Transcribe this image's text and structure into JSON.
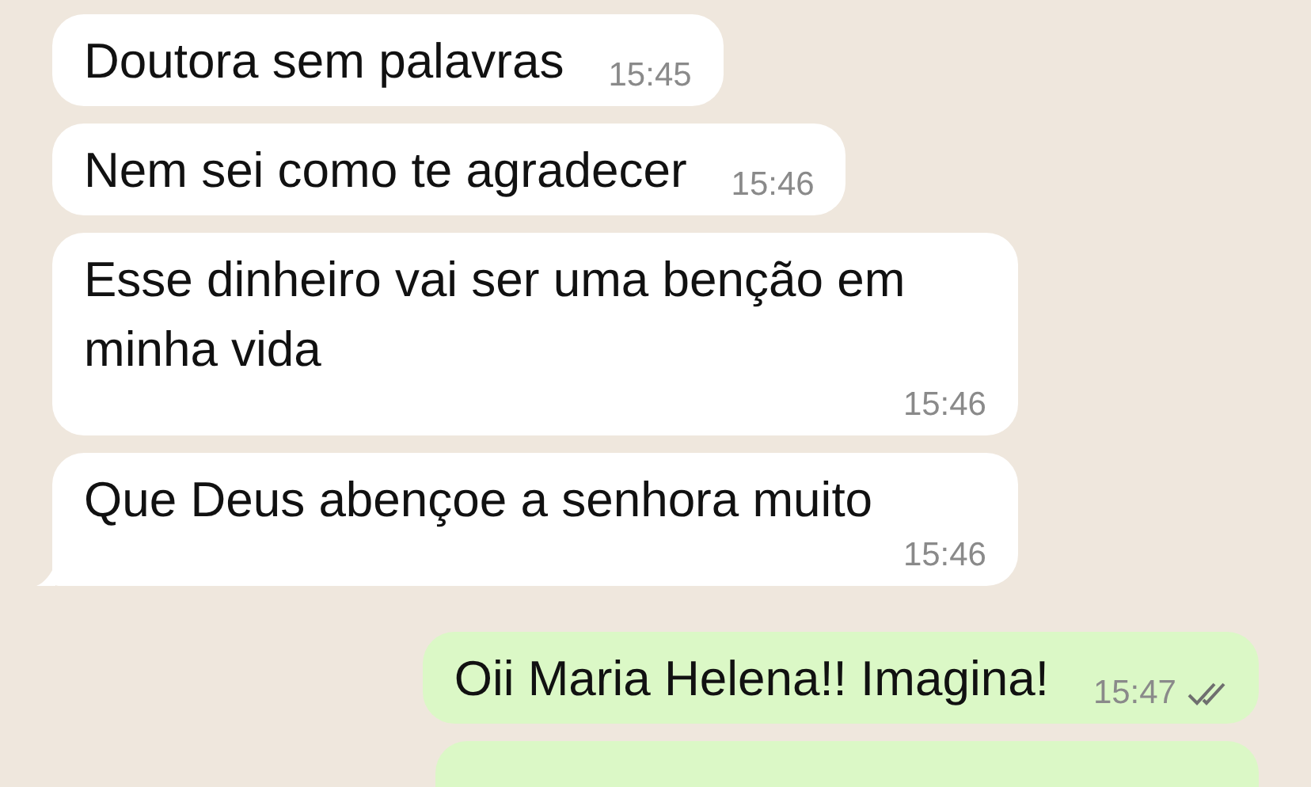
{
  "messages": [
    {
      "kind": "incoming",
      "text": "Doutora sem palavras",
      "time": "15:45",
      "tail": false
    },
    {
      "kind": "incoming",
      "text": "Nem sei como te agradecer",
      "time": "15:46",
      "tail": false
    },
    {
      "kind": "incoming",
      "text": "Esse dinheiro vai ser uma benção em minha vida",
      "time": "15:46",
      "tail": false
    },
    {
      "kind": "incoming",
      "text": "Que Deus abençoe a senhora muito",
      "time": "15:46",
      "tail": true
    },
    {
      "kind": "outgoing",
      "text": "Oii Maria Helena!! Imagina!",
      "time": "15:47",
      "tail": false,
      "read": true
    },
    {
      "kind": "outgoing"
    }
  ]
}
